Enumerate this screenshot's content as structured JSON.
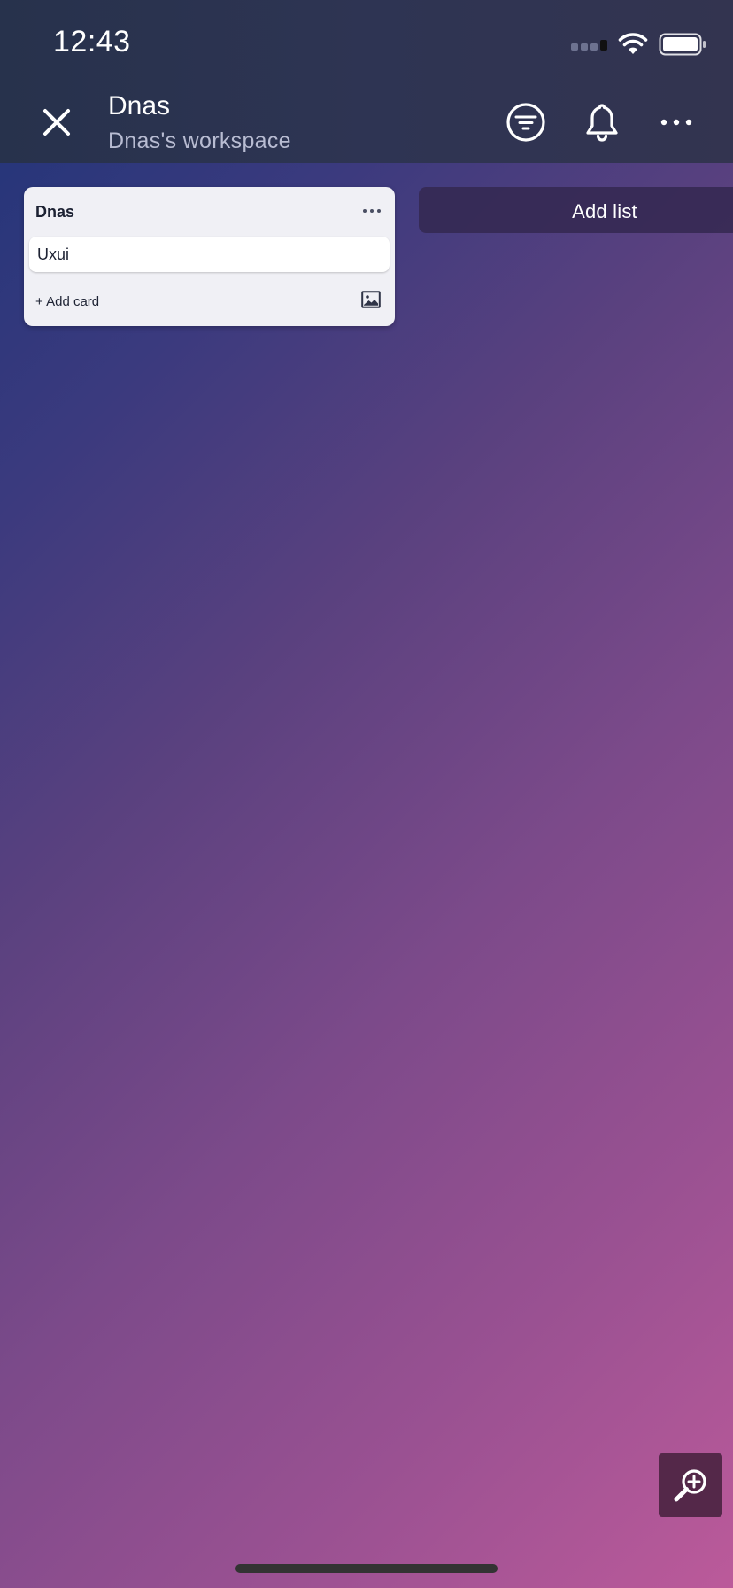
{
  "status_bar": {
    "time": "12:43"
  },
  "header": {
    "board_title": "Dnas",
    "workspace": "Dnas's workspace",
    "icons": [
      "close-icon",
      "filter-icon",
      "bell-icon",
      "more-icon"
    ]
  },
  "lists": [
    {
      "title": "Dnas",
      "cards": [
        {
          "label": "Uxui"
        }
      ],
      "add_card_label": "+ Add card"
    }
  ],
  "add_list_label": "Add list",
  "colors": {
    "header_bg": "#2e3453",
    "list_bg": "#f0f0f5",
    "zoom_button_bg": "#542849",
    "gradient_start": "#1e3478",
    "gradient_end": "#bb5a9a"
  }
}
